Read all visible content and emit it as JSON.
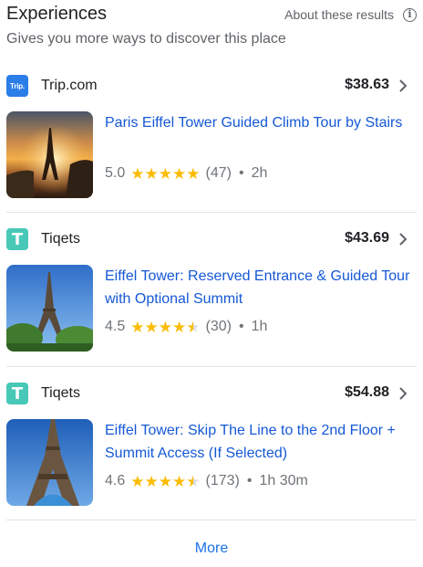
{
  "header": {
    "title": "Experiences",
    "about": "About these results",
    "subtitle": "Gives you more ways to discover this place"
  },
  "colors": {
    "link": "#1558d6",
    "star": "#fbbc04",
    "trip_logo": "#2b7de8",
    "tiqets_logo": "#48c8b7"
  },
  "cards": [
    {
      "provider": "Trip.com",
      "provider_logo_text": "Trip.",
      "price": "$38.63",
      "title": "Paris Eiffel Tower Guided Climb Tour by Stairs",
      "rating": "5.0",
      "rating_value": 5.0,
      "reviews": "(47)",
      "duration": "2h",
      "separator": "•"
    },
    {
      "provider": "Tiqets",
      "provider_logo_text": "T",
      "price": "$43.69",
      "title": "Eiffel Tower: Reserved Entrance & Guided Tour with Optional Summit",
      "rating": "4.5",
      "rating_value": 4.5,
      "reviews": "(30)",
      "duration": "1h",
      "separator": "•"
    },
    {
      "provider": "Tiqets",
      "provider_logo_text": "T",
      "price": "$54.88",
      "title": "Eiffel Tower: Skip The Line to the 2nd Floor + Summit Access (If Selected)",
      "rating": "4.6",
      "rating_value": 4.6,
      "reviews": "(173)",
      "duration": "1h 30m",
      "separator": "•"
    }
  ],
  "more_label": "More"
}
